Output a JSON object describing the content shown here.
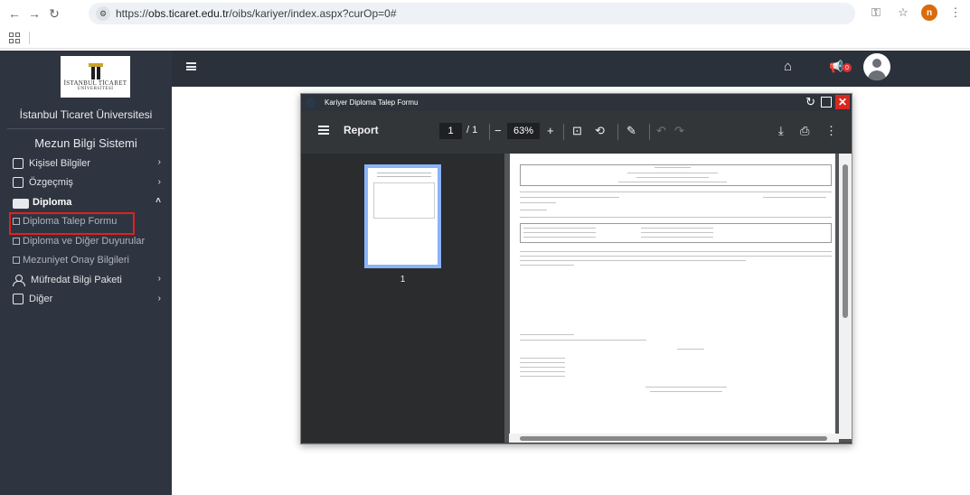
{
  "browser": {
    "url_scheme": "https://",
    "url_host": "obs.ticaret.edu.tr",
    "url_path": "/oibs/kariyer/index.aspx?curOp=0#",
    "profile_initial": "n"
  },
  "sidebar": {
    "logo_line1": "İSTANBUL TİCARET",
    "logo_line2": "ÜNİVERSİTESİ",
    "university": "İstanbul Ticaret Üniversitesi",
    "system_title": "Mezun Bilgi Sistemi",
    "items": [
      {
        "label": "Kişisel Bilgiler",
        "icon": "id-card-icon"
      },
      {
        "label": "Özgeçmiş",
        "icon": "resume-icon"
      },
      {
        "label": "Diploma",
        "icon": "diploma-icon"
      },
      {
        "label": "Müfredat Bilgi Paketi",
        "icon": "people-icon"
      },
      {
        "label": "Diğer",
        "icon": "list-icon"
      }
    ],
    "diploma_sub": [
      {
        "label": "Diploma Talep Formu"
      },
      {
        "label": "Diploma ve Diğer Duyurular"
      },
      {
        "label": "Mezuniyet Onay Bilgileri"
      }
    ]
  },
  "appbar": {
    "notification_count": "0"
  },
  "modal": {
    "title": "Kariyer Diploma Talep Formu",
    "viewer": {
      "doc_title": "Report",
      "page_current": "1",
      "page_total": "/ 1",
      "zoom": "63%",
      "thumbnail_page_number": "1"
    }
  },
  "colors": {
    "sidebar_bg": "#2f3540",
    "highlight_border": "#e02020",
    "close_red": "#d9271e",
    "badge_red": "#e03131"
  }
}
